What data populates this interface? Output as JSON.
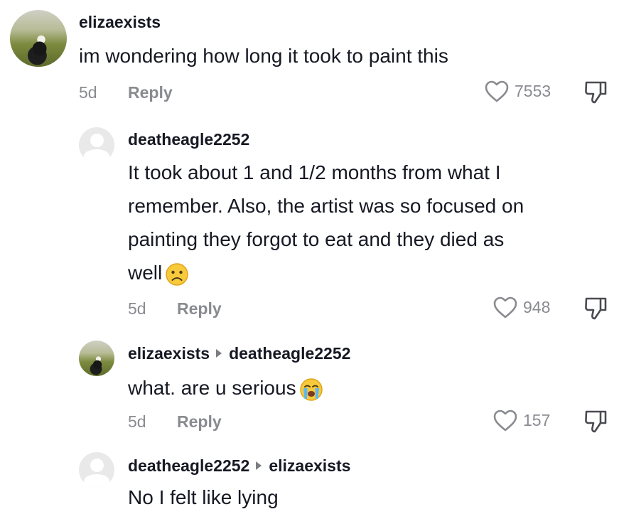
{
  "comments": [
    {
      "username": "elizaexists",
      "text": "im wondering how long it took to paint this",
      "time": "5d",
      "reply_label": "Reply",
      "likes": "7553"
    },
    {
      "username": "deatheagle2252",
      "text_lines": [
        "It took about 1 and 1/2 months from what I",
        "remember. Also, the artist was so focused on",
        "painting they forgot to eat and they died as",
        "well"
      ],
      "emoji": "sad-face",
      "time": "5d",
      "reply_label": "Reply",
      "likes": "948"
    },
    {
      "username": "elizaexists",
      "reply_to": "deatheagle2252",
      "text": "what. are u serious",
      "emoji": "crying-face",
      "time": "5d",
      "reply_label": "Reply",
      "likes": "157"
    },
    {
      "username": "deatheagle2252",
      "reply_to": "elizaexists",
      "text": "No I felt like lying"
    }
  ],
  "icons": {
    "like": "heart-outline-icon",
    "dislike": "thumbs-down-icon"
  },
  "colors": {
    "text": "#161823",
    "secondary": "#8a8b91"
  }
}
